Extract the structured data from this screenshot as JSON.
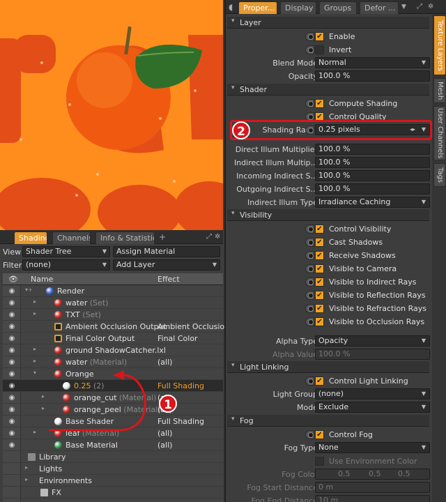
{
  "viewport_palette": {
    "bg": "#ff8d1e",
    "letter": "#e34d18",
    "orange": "#ef5a10",
    "leaf": "#2f6f2a"
  },
  "left_tabs": {
    "shading": "Shading",
    "channels": "Channels",
    "info": "Info & Statistics",
    "add": "+"
  },
  "left_rows": {
    "view_label": "View",
    "view_value": "Shader Tree",
    "assign_material": "Assign Material",
    "filter_label": "Filter",
    "filter_value": "(none)",
    "add_layer": "Add Layer"
  },
  "tree_header": {
    "name": "Name",
    "effect": "Effect"
  },
  "tree": [
    {
      "name": "Render",
      "sub": "",
      "effect": "",
      "icon": "render-sphere-icon",
      "indent": 0,
      "twisty": "▾+",
      "color": "#3e6fd8"
    },
    {
      "name": "water",
      "sub": "(Set)",
      "effect": "",
      "icon": "material-ball-icon",
      "indent": 1,
      "twisty": "▸",
      "color": "#d9302a"
    },
    {
      "name": "TXT",
      "sub": "(Set)",
      "effect": "",
      "icon": "material-ball-icon",
      "indent": 1,
      "twisty": "▸",
      "color": "#d9302a"
    },
    {
      "name": "Ambient Occlusion Output",
      "sub": "",
      "effect": "Ambient Occlusion",
      "icon": "output-icon",
      "indent": 1,
      "twisty": "",
      "color": "#d8a030"
    },
    {
      "name": "Final Color Output",
      "sub": "",
      "effect": "Final Color",
      "icon": "output-icon",
      "indent": 1,
      "twisty": "",
      "color": "#d8a030"
    },
    {
      "name": "ground ShadowCatcher.lxl",
      "sub": "",
      "effect": "",
      "icon": "material-ball-icon",
      "indent": 1,
      "twisty": "▸",
      "color": "#d9302a"
    },
    {
      "name": "water",
      "sub": "(Material)",
      "effect": "(all)",
      "icon": "material-ball-icon",
      "indent": 1,
      "twisty": "▸",
      "color": "#d9302a"
    },
    {
      "name": "Orange",
      "sub": "",
      "effect": "",
      "icon": "material-ball-icon",
      "indent": 1,
      "twisty": "▾",
      "color": "#d9302a"
    },
    {
      "name": "0.25",
      "sub": "(2)",
      "effect": "Full Shading",
      "icon": "shader-ball-icon",
      "indent": 2,
      "twisty": "",
      "color": "#eeeeee",
      "selected": true
    },
    {
      "name": "orange_cut",
      "sub": "(Material)",
      "effect": "(all)",
      "icon": "material-ball-icon",
      "indent": 2,
      "twisty": "▸",
      "color": "#d9302a"
    },
    {
      "name": "orange_peel",
      "sub": "(Material)",
      "effect": "(all)",
      "icon": "material-ball-icon",
      "indent": 2,
      "twisty": "▸",
      "color": "#d9302a"
    },
    {
      "name": "Base Shader",
      "sub": "",
      "effect": "Full Shading",
      "icon": "shader-ball-icon",
      "indent": 1,
      "twisty": "",
      "color": "#eeeeee"
    },
    {
      "name": "leaf",
      "sub": "(Material)",
      "effect": "(all)",
      "icon": "material-ball-icon",
      "indent": 1,
      "twisty": "▸",
      "color": "#d9302a"
    },
    {
      "name": "Base Material",
      "sub": "",
      "effect": "(all)",
      "icon": "base-material-icon",
      "indent": 1,
      "twisty": "",
      "color": "#3ea35a"
    },
    {
      "name": "Library",
      "sub": "",
      "effect": "",
      "icon": "library-icon",
      "indent": 0,
      "twisty": "",
      "color": ""
    },
    {
      "name": "Lights",
      "sub": "",
      "effect": "",
      "icon": "",
      "indent": 0,
      "twisty": "▸",
      "color": ""
    },
    {
      "name": "Environments",
      "sub": "",
      "effect": "",
      "icon": "",
      "indent": 0,
      "twisty": "▸",
      "color": ""
    },
    {
      "name": "FX",
      "sub": "",
      "effect": "",
      "icon": "fx-icon",
      "indent": 0,
      "twisty": "",
      "color": ""
    }
  ],
  "right_tabs": {
    "properties": "Proper...",
    "display": "Display",
    "groups": "Groups",
    "defor": "Defor ..."
  },
  "vertical_tabs": [
    "Texture Layers",
    "Mesh",
    "User Channels",
    "Tags"
  ],
  "sections": {
    "layer": {
      "title": "Layer",
      "enable": "Enable",
      "invert": "Invert",
      "blend_mode_label": "Blend Mode",
      "blend_mode": "Normal",
      "opacity_label": "Opacity",
      "opacity": "100.0 %"
    },
    "shader": {
      "title": "Shader",
      "compute_shading": "Compute Shading",
      "control_quality": "Control Quality",
      "shading_rate_label": "Shading Rate",
      "shading_rate": "0.25 pixels",
      "direct_illum_label": "Direct Illum Multiplier",
      "direct_illum": "100.0 %",
      "indirect_illum_label": "Indirect Illum Multip...",
      "indirect_illum": "100.0 %",
      "incoming_indirect_label": "Incoming Indirect S...",
      "incoming_indirect": "100.0 %",
      "outgoing_indirect_label": "Outgoing Indirect S...",
      "outgoing_indirect": "100.0 %",
      "indirect_type_label": "Indirect Illum Type",
      "indirect_type": "Irradiance Caching"
    },
    "visibility": {
      "title": "Visibility",
      "items": [
        "Control Visibility",
        "Cast Shadows",
        "Receive Shadows",
        "Visible to Camera",
        "Visible to Indirect Rays",
        "Visible to Reflection Rays",
        "Visible to Refraction Rays",
        "Visible to Occlusion Rays"
      ],
      "alpha_type_label": "Alpha Type",
      "alpha_type": "Opacity",
      "alpha_value_label": "Alpha Value",
      "alpha_value": "100.0 %"
    },
    "light_linking": {
      "title": "Light Linking",
      "control": "Control Light Linking",
      "light_group_label": "Light Group",
      "light_group": "(none)",
      "mode_label": "Mode",
      "mode": "Exclude"
    },
    "fog": {
      "title": "Fog",
      "control": "Control Fog",
      "fog_type_label": "Fog Type",
      "fog_type": "None",
      "use_env": "Use Environment Color",
      "fog_color_label": "Fog Color",
      "fog_color": [
        "0.5",
        "0.5",
        "0.5"
      ],
      "fog_start_label": "Fog Start Distance",
      "fog_start": "0 m",
      "fog_end_label": "Fog End Distance",
      "fog_end": "10 m"
    }
  },
  "annotations": {
    "one": "1",
    "two": "2"
  },
  "colors": {
    "accent": "#e79a2f",
    "check": "#f0a020",
    "annotation": "#d9161b",
    "selected_text": "#f0a020"
  }
}
